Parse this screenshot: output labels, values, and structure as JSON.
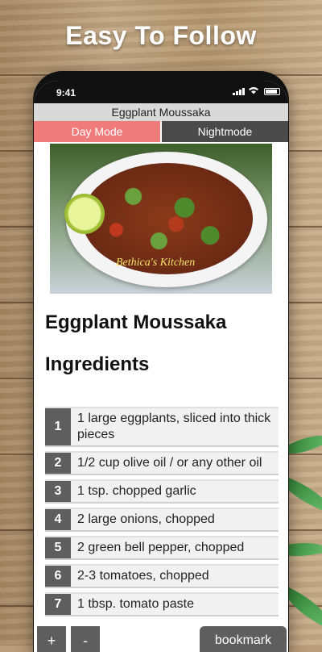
{
  "promo": {
    "title": "Easy To Follow"
  },
  "status": {
    "time": "9:41"
  },
  "app": {
    "title": "Eggplant Moussaka",
    "modes": {
      "day": "Day Mode",
      "night": "Nightmode"
    }
  },
  "recipe": {
    "image_watermark": "Bethica's Kitchen",
    "title": "Eggplant Moussaka",
    "ingredients_heading": "Ingredients",
    "ingredients": [
      {
        "num": "1",
        "text": "1 large eggplants, sliced into thick pieces"
      },
      {
        "num": "2",
        "text": "1/2 cup olive oil / or any other oil"
      },
      {
        "num": "3",
        "text": "1 tsp. chopped garlic"
      },
      {
        "num": "4",
        "text": "2 large onions, chopped"
      },
      {
        "num": "5",
        "text": "2 green bell pepper, chopped"
      },
      {
        "num": "6",
        "text": "2-3 tomatoes, chopped"
      },
      {
        "num": "7",
        "text": "1 tbsp. tomato paste"
      }
    ]
  },
  "controls": {
    "plus": "+",
    "minus": "-",
    "bookmark": "bookmark"
  },
  "colors": {
    "day_mode": "#f07b7b",
    "night_mode": "#4a4a4a",
    "number_badge": "#5e5e5e"
  }
}
